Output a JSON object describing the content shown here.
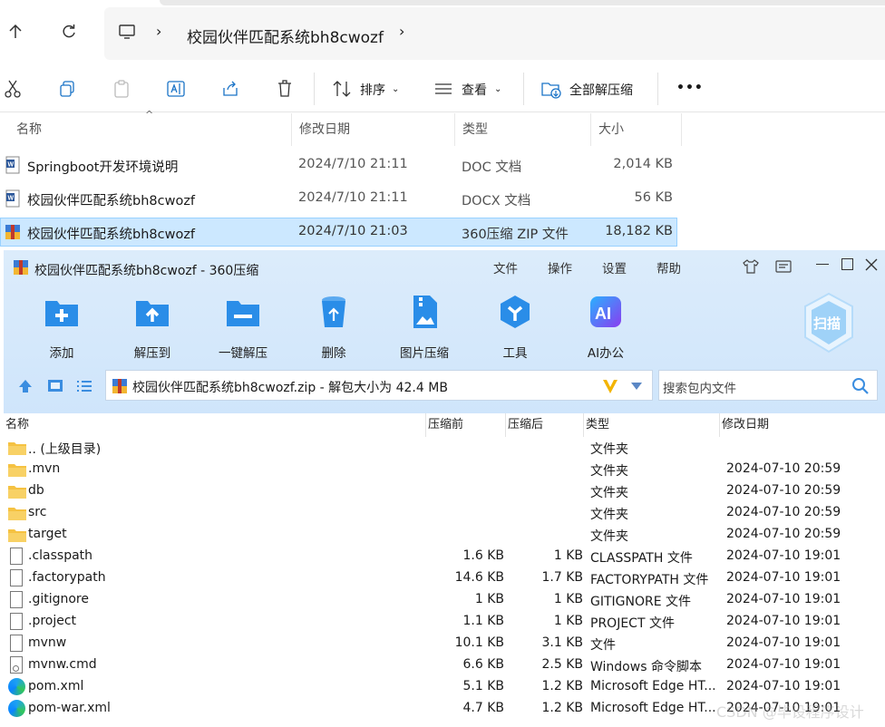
{
  "explorer": {
    "breadcrumb": [
      "校园伙伴匹配系统bh8cwozf"
    ],
    "commands": {
      "sort": "排序",
      "view": "查看",
      "extract_all": "全部解压缩",
      "more": "•••"
    },
    "columns": [
      "名称",
      "修改日期",
      "类型",
      "大小"
    ],
    "files": [
      {
        "name": "Springboot开发环境说明",
        "date": "2024/7/10 21:11",
        "type": "DOC 文档",
        "size": "2,014 KB",
        "icon": "word-doc-icon",
        "selected": false
      },
      {
        "name": "校园伙伴匹配系统bh8cwozf",
        "date": "2024/7/10 21:11",
        "type": "DOCX 文档",
        "size": "56 KB",
        "icon": "word-docx-icon",
        "selected": false
      },
      {
        "name": "校园伙伴匹配系统bh8cwozf",
        "date": "2024/7/10 21:03",
        "type": "360压缩 ZIP 文件",
        "size": "18,182 KB",
        "icon": "zip-archive-icon",
        "selected": true
      }
    ]
  },
  "zip_window": {
    "title": "校园伙伴匹配系统bh8cwozf - 360压缩",
    "menu": [
      "文件",
      "操作",
      "设置",
      "帮助"
    ],
    "tools": [
      {
        "label": "添加",
        "color": "#2a8de8"
      },
      {
        "label": "解压到",
        "color": "#2a8de8"
      },
      {
        "label": "一键解压",
        "color": "#2a8de8"
      },
      {
        "label": "删除",
        "color": "#2a8de8"
      },
      {
        "label": "图片压缩",
        "color": "#2a8de8"
      },
      {
        "label": "工具",
        "color": "#2a8de8"
      },
      {
        "label": "AI办公",
        "color": "#6b4df0"
      }
    ],
    "scan_label": "扫描",
    "path": "校园伙伴匹配系统bh8cwozf.zip - 解包大小为 42.4 MB",
    "search_placeholder": "搜索包内文件",
    "columns": [
      "名称",
      "压缩前",
      "压缩后",
      "类型",
      "修改日期"
    ],
    "rows": [
      {
        "name": ".. (上级目录)",
        "before": "",
        "after": "",
        "type": "文件夹",
        "date": "",
        "icon": "folder"
      },
      {
        "name": ".mvn",
        "before": "",
        "after": "",
        "type": "文件夹",
        "date": "2024-07-10 20:59",
        "icon": "folder"
      },
      {
        "name": "db",
        "before": "",
        "after": "",
        "type": "文件夹",
        "date": "2024-07-10 20:59",
        "icon": "folder"
      },
      {
        "name": "src",
        "before": "",
        "after": "",
        "type": "文件夹",
        "date": "2024-07-10 20:59",
        "icon": "folder"
      },
      {
        "name": "target",
        "before": "",
        "after": "",
        "type": "文件夹",
        "date": "2024-07-10 20:59",
        "icon": "folder"
      },
      {
        "name": ".classpath",
        "before": "1.6 KB",
        "after": "1 KB",
        "type": "CLASSPATH 文件",
        "date": "2024-07-10 19:01",
        "icon": "file"
      },
      {
        "name": ".factorypath",
        "before": "14.6 KB",
        "after": "1.7 KB",
        "type": "FACTORYPATH 文件",
        "date": "2024-07-10 19:01",
        "icon": "file"
      },
      {
        "name": ".gitignore",
        "before": "1 KB",
        "after": "1 KB",
        "type": "GITIGNORE 文件",
        "date": "2024-07-10 19:01",
        "icon": "file"
      },
      {
        "name": ".project",
        "before": "1.1 KB",
        "after": "1 KB",
        "type": "PROJECT 文件",
        "date": "2024-07-10 19:01",
        "icon": "file"
      },
      {
        "name": "mvnw",
        "before": "10.1 KB",
        "after": "3.1 KB",
        "type": "文件",
        "date": "2024-07-10 19:01",
        "icon": "file"
      },
      {
        "name": "mvnw.cmd",
        "before": "6.6 KB",
        "after": "2.5 KB",
        "type": "Windows 命令脚本",
        "date": "2024-07-10 19:01",
        "icon": "cmd"
      },
      {
        "name": "pom.xml",
        "before": "5.1 KB",
        "after": "1.2 KB",
        "type": "Microsoft Edge HT...",
        "date": "2024-07-10 19:01",
        "icon": "edge"
      },
      {
        "name": "pom-war.xml",
        "before": "4.7 KB",
        "after": "1.2 KB",
        "type": "Microsoft Edge HT...",
        "date": "2024-07-10 19:01",
        "icon": "edge"
      }
    ]
  },
  "watermark": "CSDN @毕设程序设计"
}
